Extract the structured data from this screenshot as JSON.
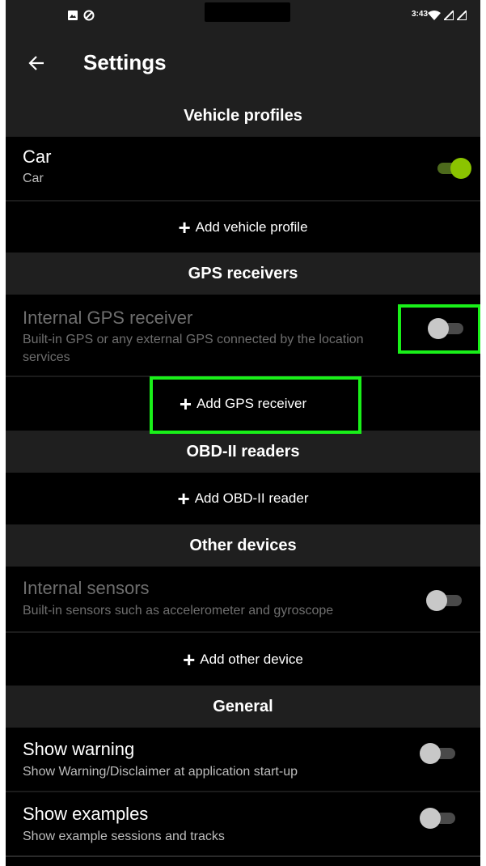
{
  "status_bar": {
    "time": "3:43",
    "icons": [
      "gallery-icon",
      "no-sync-icon",
      "wifi-icon",
      "signal-icon",
      "signal-icon"
    ]
  },
  "app_bar": {
    "title": "Settings",
    "back_icon": "arrow-back-icon"
  },
  "sections": {
    "vehicle_profiles": {
      "header": "Vehicle profiles",
      "car": {
        "title": "Car",
        "subtitle": "Car",
        "enabled": true
      },
      "add_label": "Add vehicle profile"
    },
    "gps_receivers": {
      "header": "GPS receivers",
      "internal": {
        "title": "Internal GPS receiver",
        "subtitle": "Built-in GPS or any external GPS connected by the location services",
        "enabled": false
      },
      "add_label": "Add GPS receiver"
    },
    "obd_readers": {
      "header": "OBD-II readers",
      "add_label": "Add OBD-II reader"
    },
    "other_devices": {
      "header": "Other devices",
      "sensors": {
        "title": "Internal sensors",
        "subtitle": "Built-in sensors such as accelerometer and gyroscope",
        "enabled": false
      },
      "add_label": "Add other device"
    },
    "general": {
      "header": "General",
      "warning": {
        "title": "Show warning",
        "subtitle": "Show Warning/Disclaimer at application start-up",
        "enabled": false
      },
      "examples": {
        "title": "Show examples",
        "subtitle": "Show example sessions and tracks",
        "enabled": false
      }
    }
  },
  "colors": {
    "accent": "#8bc400",
    "highlight": "#19f019",
    "background": "#000000",
    "header": "#1f1f1f"
  }
}
